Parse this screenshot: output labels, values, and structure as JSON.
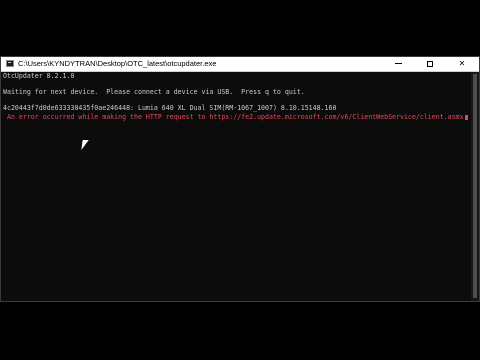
{
  "window": {
    "title": "C:\\Users\\KYNDYTRAN\\Desktop\\OTC_latest\\otcupdater.exe",
    "icon": "console-icon",
    "controls": {
      "minimize_icon": "minimize-icon",
      "maximize_icon": "maximize-icon",
      "close_glyph": "✕"
    }
  },
  "console": {
    "lines": [
      "OtcUpdater 8.2.1.0",
      "Waiting for next device.  Please connect a device via USB.  Press q to quit.",
      "4c20443f7d0de633338435f0ae246448: Lumia 640 XL Dual SIM(RM-1067_1007) 8.10.15148.160",
      " An error occurred while making the HTTP request to https://fe2.update.microsoft.com/v6/ClientWebService/client.asmx. T"
    ]
  },
  "colors": {
    "console_background": "#0c0c0c",
    "console_text": "#cccccc",
    "error_text": "#e74856",
    "titlebar": "#ffffff"
  }
}
